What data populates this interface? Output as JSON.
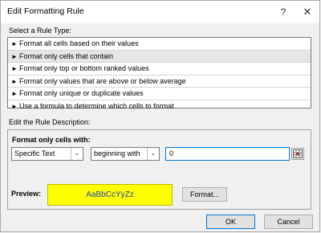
{
  "window": {
    "title": "Edit Formatting Rule",
    "help_glyph": "?",
    "close_glyph": "✕"
  },
  "rule_type": {
    "label": "Select a Rule Type:",
    "items": [
      {
        "label": "Format all cells based on their values",
        "selected": false
      },
      {
        "label": "Format only cells that contain",
        "selected": true
      },
      {
        "label": "Format only top or bottom ranked values",
        "selected": false
      },
      {
        "label": "Format only values that are above or below average",
        "selected": false
      },
      {
        "label": "Format only unique or duplicate values",
        "selected": false
      },
      {
        "label": "Use a formula to determine which cells to format",
        "selected": false
      }
    ],
    "item_arrow": "►"
  },
  "description": {
    "label": "Edit the Rule Description:",
    "subheading": "Format only cells with:",
    "condition_type": "Specific Text",
    "operator": "beginning with",
    "value": "0",
    "dropdown_glyph": "⌄"
  },
  "preview": {
    "label": "Preview:",
    "sample_text": "AaBbCcYyZz",
    "fill_color": "#ffff00",
    "text_color": "#1f3fbf"
  },
  "buttons": {
    "format": "Format...",
    "ok": "OK",
    "cancel": "Cancel"
  }
}
